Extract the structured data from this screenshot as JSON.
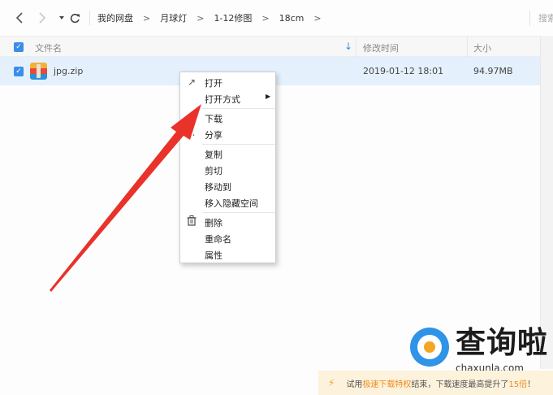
{
  "toolbar": {
    "back_icon": "chevron-left-icon",
    "forward_icon": "chevron-right-icon",
    "breadcrumb": [
      "我的网盘",
      "月球灯",
      "1-12修图",
      "18cm"
    ],
    "search_placeholder": "搜索"
  },
  "table": {
    "columns": {
      "name": "文件名",
      "modified": "修改时间",
      "size": "大小"
    },
    "rows": [
      {
        "name": "jpg.zip",
        "modified": "2019-01-12 18:01",
        "size": "94.97MB",
        "selected": true
      }
    ]
  },
  "context_menu": {
    "items": [
      "打开",
      "打开方式",
      "下载",
      "分享",
      "复制",
      "剪切",
      "移动到",
      "移入隐藏空间",
      "删除",
      "重命名",
      "属性"
    ]
  },
  "promo": {
    "prefix": "试用",
    "highlight": "极速下载特权",
    "middle": "结束，",
    "text2": "下载速度最高提升了",
    "multiplier": "15倍",
    "suffix": "！"
  },
  "watermark": {
    "url": "chaxunla.com"
  },
  "colors": {
    "accent": "#3b8ee8",
    "selected_row": "#e4f1fd",
    "annotation_arrow": "#e8322a",
    "promo_bg": "#fdf2dc",
    "promo_highlight": "#ee8a1d"
  }
}
